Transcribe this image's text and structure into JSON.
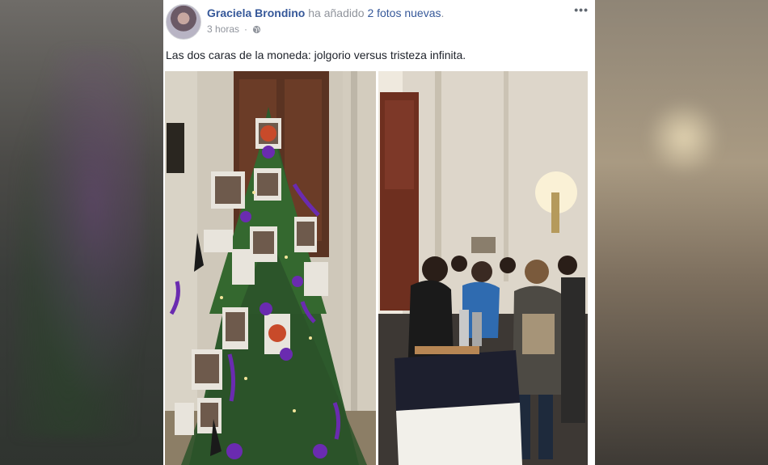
{
  "post": {
    "author": "Graciela Brondino",
    "action_prefix": "ha añadido",
    "action_link": "2 fotos nuevas",
    "action_suffix": ".",
    "time": "3 horas",
    "privacy_icon": "globe-icon",
    "menu_icon": "more-options-icon",
    "text": "Las dos caras de la moneda: jolgorio versus tristeza infinita.",
    "photos": [
      {
        "description_name": "christmas-tree-photo"
      },
      {
        "description_name": "party-crowd-photo"
      }
    ]
  },
  "colors": {
    "link": "#365899",
    "meta": "#90949c",
    "text": "#1d2129",
    "ribbon": "#6a2bb0"
  }
}
